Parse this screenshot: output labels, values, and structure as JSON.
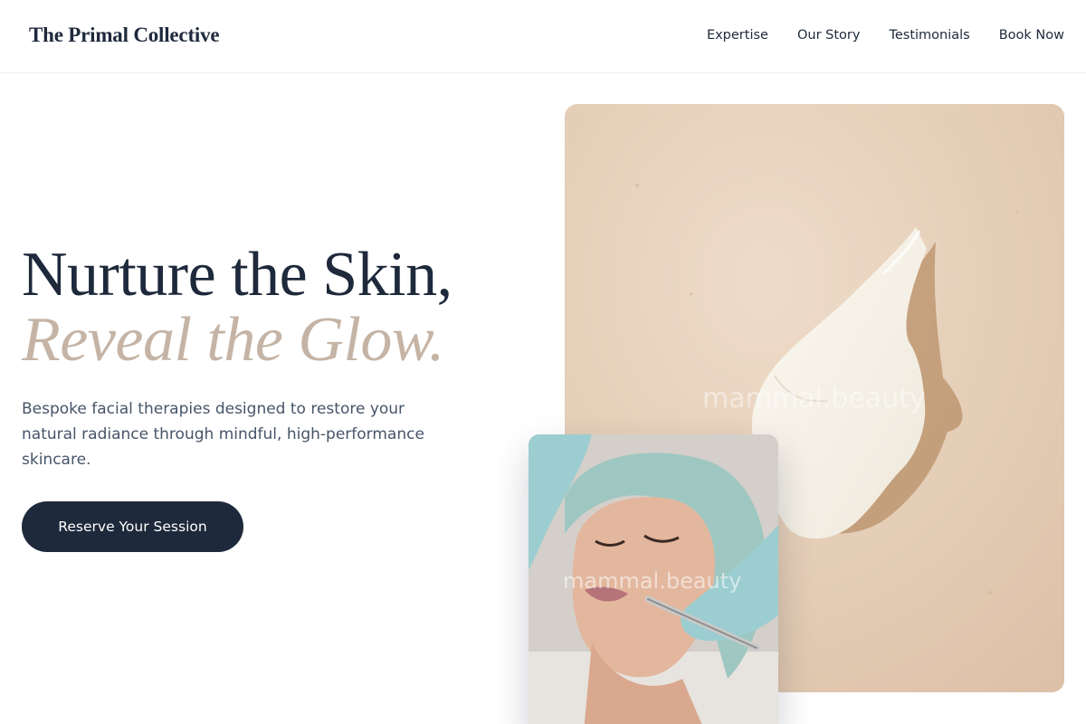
{
  "brand": {
    "name": "The Primal Collective"
  },
  "nav": {
    "items": [
      "Expertise",
      "Our Story",
      "Testimonials",
      "Book Now"
    ]
  },
  "hero": {
    "headline_line1": "Nurture the Skin,",
    "headline_line2": "Reveal the Glow.",
    "description": "Bespoke facial therapies designed to restore your natural radiance through mindful, high-performance skincare.",
    "cta_label": "Reserve Your Session"
  },
  "images": {
    "cream": {
      "subject": "cream-texture-swatch",
      "watermark": "mammal.beauty"
    },
    "facial": {
      "subject": "facial-treatment-photo",
      "watermark": "mammal.beauty"
    }
  },
  "colors": {
    "primary": "#1e293b",
    "accent": "#c5b4a5",
    "body_text": "#475569",
    "cream_bg": "#e6cfb8"
  }
}
